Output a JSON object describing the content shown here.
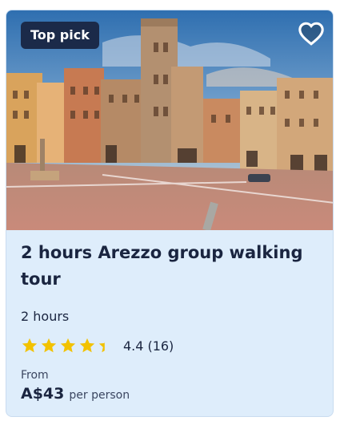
{
  "card": {
    "badge": "Top pick",
    "title": "2 hours Arezzo group walking tour",
    "duration": "2 hours",
    "rating": {
      "stars": 4.4,
      "value": "4.4",
      "count": "(16)"
    },
    "price": {
      "from_label": "From",
      "amount": "A$43",
      "unit": "per person"
    }
  },
  "icons": {
    "favorite": "heart-icon",
    "star": "star-icon"
  },
  "colors": {
    "badge_bg": "#1b2a49",
    "card_bg": "#deedfb",
    "star": "#f2c200",
    "text": "#1a2540"
  }
}
